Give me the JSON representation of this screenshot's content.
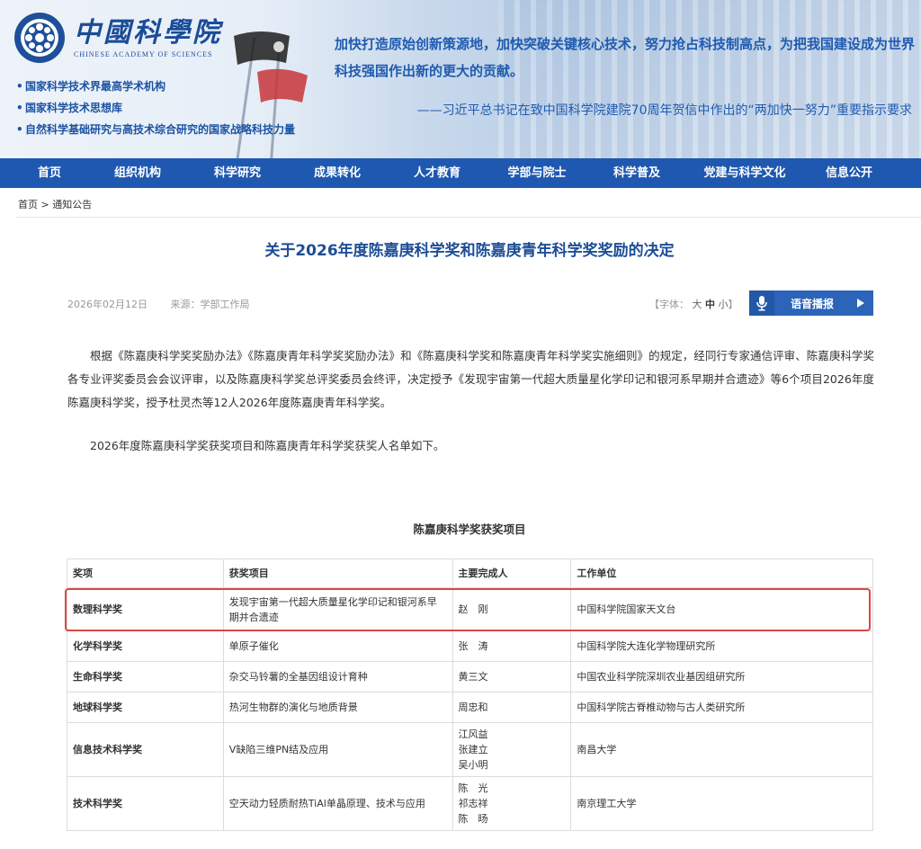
{
  "banner": {
    "logo_cn": "中國科學院",
    "logo_en": "CHINESE ACADEMY OF SCIENCES",
    "taglines": [
      "国家科学技术界最高学术机构",
      "国家科学技术思想库",
      "自然科学基础研究与高技术综合研究的国家战略科技力量"
    ],
    "quote_main": "加快打造原始创新策源地，加快突破关键核心技术，努力抢占科技制高点，为把我国建设成为世界科技强国作出新的更大的贡献。",
    "quote_source": "——习近平总书记在致中国科学院建院70周年贺信中作出的“两加快一努力”重要指示要求"
  },
  "nav": {
    "items": [
      "首页",
      "组织机构",
      "科学研究",
      "成果转化",
      "人才教育",
      "学部与院士",
      "科学普及",
      "党建与科学文化",
      "信息公开"
    ]
  },
  "breadcrumb": {
    "home": "首页",
    "sep": ">",
    "current": "通知公告"
  },
  "article": {
    "title": "关于2026年度陈嘉庚科学奖和陈嘉庚青年科学奖奖励的决定",
    "date": "2026年02月12日",
    "source": "来源：学部工作局",
    "font_label_prefix": "【字体：",
    "font_large": "大",
    "font_medium": "中",
    "font_small": "小",
    "font_label_suffix": "】",
    "voice_label": "语音播报",
    "para1": "根据《陈嘉庚科学奖奖励办法》《陈嘉庚青年科学奖奖励办法》和《陈嘉庚科学奖和陈嘉庚青年科学奖实施细则》的规定，经同行专家通信评审、陈嘉庚科学奖各专业评奖委员会会议评审，以及陈嘉庚科学奖总评奖委员会终评，决定授予《发现宇宙第一代超大质量星化学印记和银河系早期并合遗迹》等6个项目2026年度陈嘉庚科学奖，授予杜灵杰等12人2026年度陈嘉庚青年科学奖。",
    "para2": "2026年度陈嘉庚科学奖获奖项目和陈嘉庚青年科学奖获奖人名单如下。"
  },
  "table": {
    "title": "陈嘉庚科学奖获奖项目",
    "headers": [
      "奖项",
      "获奖项目",
      "主要完成人",
      "工作单位"
    ],
    "rows": [
      {
        "award": "数理科学奖",
        "project": "发现宇宙第一代超大质量星化学印记和银河系早期并合遗迹",
        "people": [
          "赵　刚"
        ],
        "org": "中国科学院国家天文台"
      },
      {
        "award": "化学科学奖",
        "project": "单原子催化",
        "people": [
          "张　涛"
        ],
        "org": "中国科学院大连化学物理研究所"
      },
      {
        "award": "生命科学奖",
        "project": "杂交马铃薯的全基因组设计育种",
        "people": [
          "黄三文"
        ],
        "org": "中国农业科学院深圳农业基因组研究所"
      },
      {
        "award": "地球科学奖",
        "project": "热河生物群的演化与地质背景",
        "people": [
          "周忠和"
        ],
        "org": "中国科学院古脊椎动物与古人类研究所"
      },
      {
        "award": "信息技术科学奖",
        "project": "V缺陷三维PN结及应用",
        "people": [
          "江风益",
          "张建立",
          "吴小明"
        ],
        "org": "南昌大学"
      },
      {
        "award": "技术科学奖",
        "project": "空天动力轻质耐热TiAl单晶原理、技术与应用",
        "people": [
          "陈　光",
          "祁志祥",
          "陈　旸"
        ],
        "org": "南京理工大学"
      }
    ]
  },
  "colors": {
    "nav_bg": "#1f58b0",
    "title": "#1d4d97",
    "highlight": "#d94848"
  }
}
